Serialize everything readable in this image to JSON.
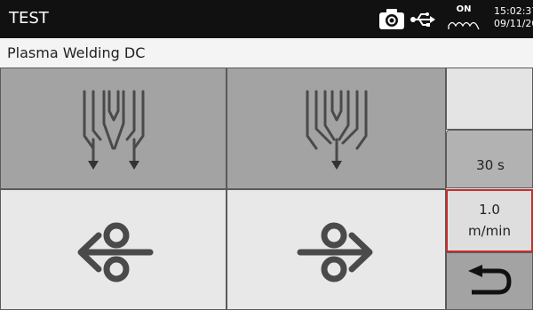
{
  "header": {
    "title": "TEST",
    "status_icons": [
      "camera-icon",
      "usb-icon",
      "heating-on-icon"
    ],
    "heat_label": "ON",
    "time": "15:02:37",
    "date": "09/11/20"
  },
  "subtitle": "Plasma Welding  DC",
  "tiles": [
    {
      "icon": "torch-gas-spread-icon"
    },
    {
      "icon": "torch-gas-focused-icon"
    },
    {
      "icon": "wire-feed-reverse-icon"
    },
    {
      "icon": "wire-feed-forward-icon"
    }
  ],
  "side": {
    "time_value": "30 s",
    "speed_value": "1.0",
    "speed_unit": "m/min",
    "back_icon": "return-arrow-icon"
  },
  "colors": {
    "header_bg": "#111111",
    "tile_dark": "#a3a3a3",
    "tile_light": "#e8e8e8",
    "selected_border": "#c42f2f",
    "icon": "#4a4a4a"
  }
}
